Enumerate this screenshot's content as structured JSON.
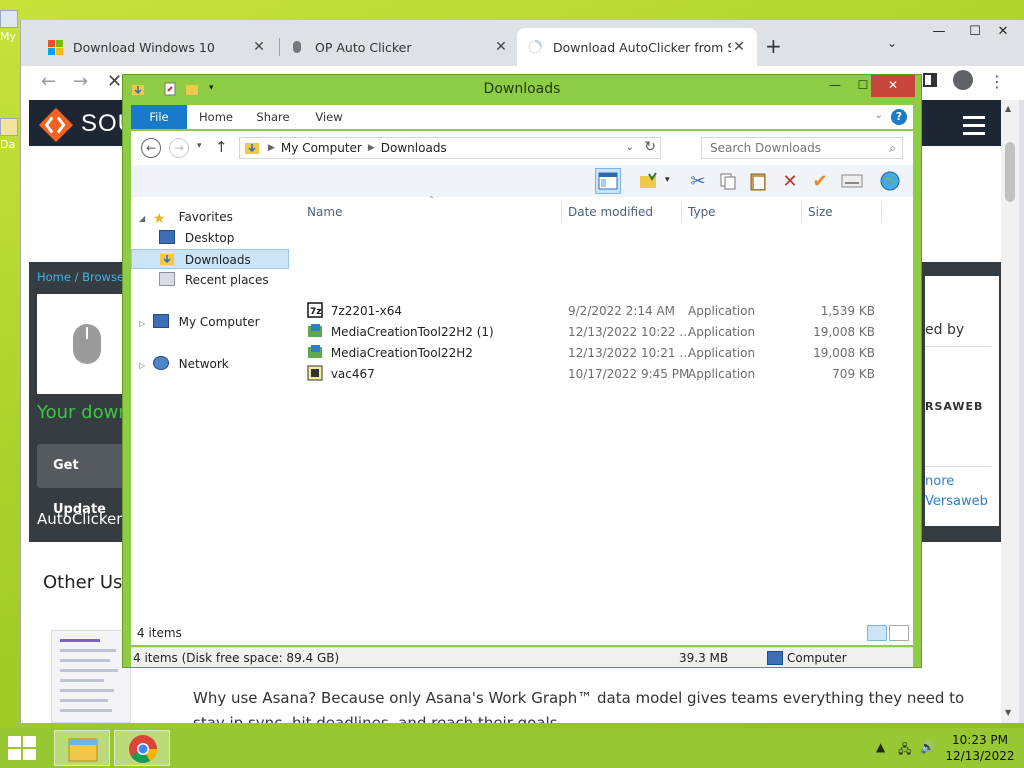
{
  "desktop": {
    "labels": [
      "My",
      "Da"
    ]
  },
  "browser": {
    "tabs": [
      {
        "title": "Download Windows 10",
        "close": "✕"
      },
      {
        "title": "OP Auto Clicker",
        "close": "✕"
      },
      {
        "title": "Download AutoClicker from Sou",
        "close": "✕"
      }
    ],
    "new_tab": "+",
    "tab_menu": "⌄",
    "window_controls": {
      "minimize": "—",
      "maximize": "☐",
      "close": "✕"
    },
    "nav": {
      "back": "←",
      "forward": "→",
      "stop": "✕"
    },
    "page": {
      "site_name": "SOU",
      "breadcrumb": "Home / Browse /",
      "your_download": "Your down",
      "get_updates": "Get Update",
      "autoclicker": "AutoClicker.",
      "other_useful": "Other Use",
      "side_text": "ed by",
      "side_brand": "RSAWEB",
      "side_link1": "nore",
      "side_link2": "Versaweb",
      "article": "Why use Asana? Because only Asana's Work Graph™ data model gives teams everything they need to stay in sync, hit deadlines, and reach their goals."
    }
  },
  "explorer": {
    "title": "Downloads",
    "controls": {
      "minimize": "—",
      "maximize": "☐",
      "close": "✕"
    },
    "ribbon_tabs": [
      "File",
      "Home",
      "Share",
      "View"
    ],
    "help": "?",
    "breadcrumb": [
      "My Computer",
      "Downloads"
    ],
    "search_placeholder": "Search Downloads",
    "nav_pane": {
      "favorites": "Favorites",
      "desktop": "Desktop",
      "downloads": "Downloads",
      "recent": "Recent places",
      "my_computer": "My Computer",
      "network": "Network"
    },
    "columns": [
      "Name",
      "Date modified",
      "Type",
      "Size"
    ],
    "files": [
      {
        "name": "7z2201-x64",
        "date": "9/2/2022 2:14 AM",
        "type": "Application",
        "size": "1,539 KB",
        "icon": "7zip-icon"
      },
      {
        "name": "MediaCreationTool22H2 (1)",
        "date": "12/13/2022 10:22 ...",
        "type": "Application",
        "size": "19,008 KB",
        "icon": "setup-icon"
      },
      {
        "name": "MediaCreationTool22H2",
        "date": "12/13/2022 10:21 ...",
        "type": "Application",
        "size": "19,008 KB",
        "icon": "setup-icon"
      },
      {
        "name": "vac467",
        "date": "10/17/2022 9:45 PM",
        "type": "Application",
        "size": "709 KB",
        "icon": "app-icon"
      }
    ],
    "item_count": "4 items",
    "status": {
      "left": "4 items (Disk free space: 89.4 GB)",
      "size": "39.3 MB",
      "location": "Computer"
    }
  },
  "taskbar": {
    "clock_time": "10:23 PM",
    "clock_date": "12/13/2022"
  },
  "colors": {
    "explorer_frame": "#8fcc45",
    "file_tab": "#1979ca",
    "close_red": "#c9463d",
    "taskbar": "#97c732"
  }
}
